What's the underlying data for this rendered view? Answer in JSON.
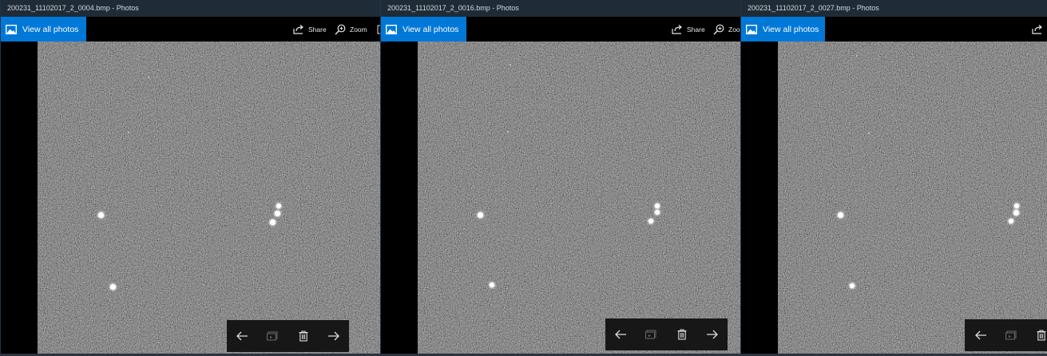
{
  "windows": [
    {
      "title": "200231_11102017_2_0004.bmp - Photos",
      "view_all_label": "View all photos",
      "share_label": "Share",
      "zoom_label": "Zoom"
    },
    {
      "title": "200231_11102017_2_0016.bmp - Photos",
      "view_all_label": "View all photos",
      "share_label": "Share",
      "zoom_label": "Zoo"
    },
    {
      "title": "200231_11102017_2_0027.bmp - Photos",
      "view_all_label": "View all photos"
    }
  ],
  "colors": {
    "accent": "#0078d7",
    "titlebar": "#1f2b36",
    "image_gray": "#6d6d6d",
    "navbar": "#171717"
  },
  "icons": [
    "photos-app-icon",
    "share-icon",
    "zoom-icon",
    "previous-arrow-icon",
    "slideshow-icon",
    "delete-icon",
    "next-arrow-icon"
  ]
}
